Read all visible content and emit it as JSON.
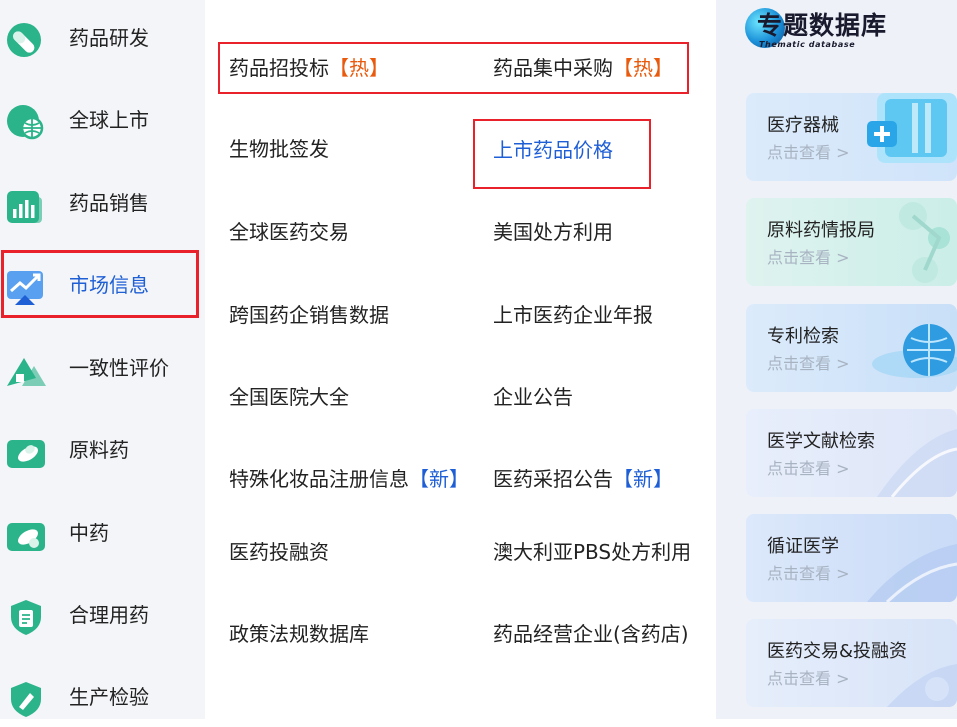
{
  "sidebar": {
    "items": [
      {
        "label": "药品研发",
        "icon": "capsule-icon"
      },
      {
        "label": "全球上市",
        "icon": "globe-icon"
      },
      {
        "label": "药品销售",
        "icon": "sales-chart-icon"
      },
      {
        "label": "市场信息",
        "icon": "market-trend-icon",
        "active": true
      },
      {
        "label": "一致性评价",
        "icon": "consistency-eval-icon"
      },
      {
        "label": "原料药",
        "icon": "raw-material-icon"
      },
      {
        "label": "中药",
        "icon": "herbal-medicine-icon"
      },
      {
        "label": "合理用药",
        "icon": "rational-use-shield-icon"
      },
      {
        "label": "生产检验",
        "icon": "production-inspection-icon"
      }
    ]
  },
  "menu": {
    "drug_tender": {
      "label": "药品招投标",
      "tag": "【热】"
    },
    "central_procurement": {
      "label": "药品集中采购",
      "tag": "【热】"
    },
    "bio_batch": {
      "label": "生物批签发"
    },
    "market_price": {
      "label": "上市药品价格"
    },
    "global_trade": {
      "label": "全球医药交易"
    },
    "us_prescription": {
      "label": "美国处方利用"
    },
    "multinational_sales": {
      "label": "跨国药企销售数据"
    },
    "listed_annual_report": {
      "label": "上市医药企业年报"
    },
    "hospital_directory": {
      "label": "全国医院大全"
    },
    "company_notice": {
      "label": "企业公告"
    },
    "special_cosmetics": {
      "label": "特殊化妆品注册信息",
      "tag": "【新】"
    },
    "procurement_notice": {
      "label": "医药采招公告",
      "tag": "【新】"
    },
    "investment": {
      "label": "医药投融资"
    },
    "australia_pbs": {
      "label": "澳大利亚PBS处方利用"
    },
    "policy_db": {
      "label": "政策法规数据库"
    },
    "drug_business": {
      "label": "药品经营企业(含药店)"
    }
  },
  "thematic": {
    "title": "专题数据库",
    "subtitle": "Thematic database",
    "cards": [
      {
        "title": "医疗器械",
        "sub": "点击查看 >",
        "art": "medical-device-art"
      },
      {
        "title": "原料药情报局",
        "sub": "点击查看 >",
        "art": "molecule-art"
      },
      {
        "title": "专利检索",
        "sub": "点击查看 >",
        "art": "patent-globe-art"
      },
      {
        "title": "医学文献检索",
        "sub": "点击查看 >",
        "art": "literature-art"
      },
      {
        "title": "循证医学",
        "sub": "点击查看 >",
        "art": "evidence-art"
      },
      {
        "title": "医药交易&投融资",
        "sub": "点击查看 >",
        "art": "trade-finance-art"
      }
    ]
  },
  "colors": {
    "accent_blue": "#1f5fd6",
    "hot_orange": "#e95a0c",
    "highlight_red": "#e8212b",
    "icon_green": "#2bb38a"
  }
}
